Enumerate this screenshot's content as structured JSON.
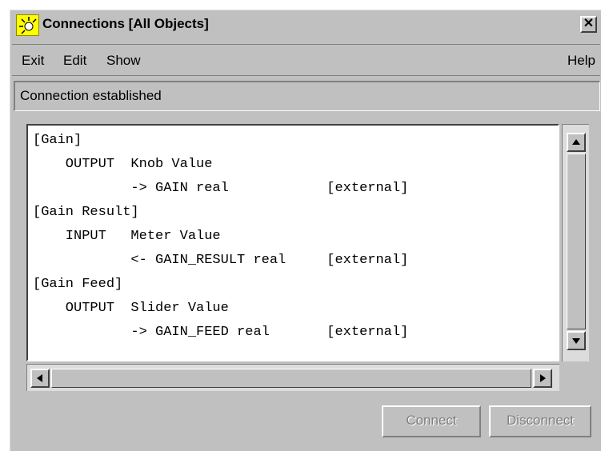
{
  "window": {
    "title": "Connections [All Objects]",
    "close_glyph": "✕",
    "icon": "app-sun-icon"
  },
  "menu": {
    "items": [
      "Exit",
      "Edit",
      "Show"
    ],
    "help": "Help"
  },
  "status": "Connection established",
  "connections_text": [
    "[Gain]",
    "    OUTPUT  Knob Value",
    "            -> GAIN real            [external]",
    "[Gain Result]",
    "    INPUT   Meter Value",
    "            <- GAIN_RESULT real     [external]",
    "[Gain Feed]",
    "    OUTPUT  Slider Value",
    "            -> GAIN_FEED real       [external]"
  ],
  "buttons": {
    "connect": "Connect",
    "disconnect": "Disconnect"
  },
  "colors": {
    "face": "#c0c0c0",
    "icon_bg": "#ffff00",
    "disabled_text": "#808080"
  }
}
